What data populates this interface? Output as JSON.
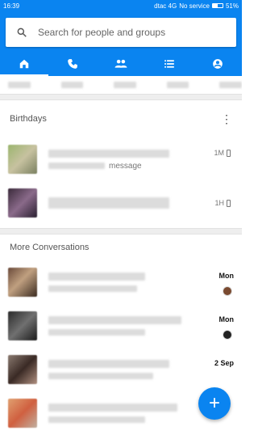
{
  "status": {
    "time": "16:39",
    "carrier": "dtac 4G",
    "service": "No service",
    "battery": "51%"
  },
  "search": {
    "placeholder": "Search for people and groups"
  },
  "tabs": [
    "home",
    "calls",
    "people",
    "groups",
    "profile"
  ],
  "sections": {
    "birthdays": "Birthdays",
    "more": "More Conversations"
  },
  "birthdays": [
    {
      "preview": "message",
      "meta": "1M"
    },
    {
      "preview": "",
      "meta": "1H"
    }
  ],
  "conversations": [
    {
      "date": "Mon"
    },
    {
      "date": "Mon"
    },
    {
      "date": "2 Sep"
    },
    {
      "date": ""
    }
  ],
  "fab": {
    "label": "+"
  },
  "colors": {
    "accent": "#0a84f0"
  }
}
